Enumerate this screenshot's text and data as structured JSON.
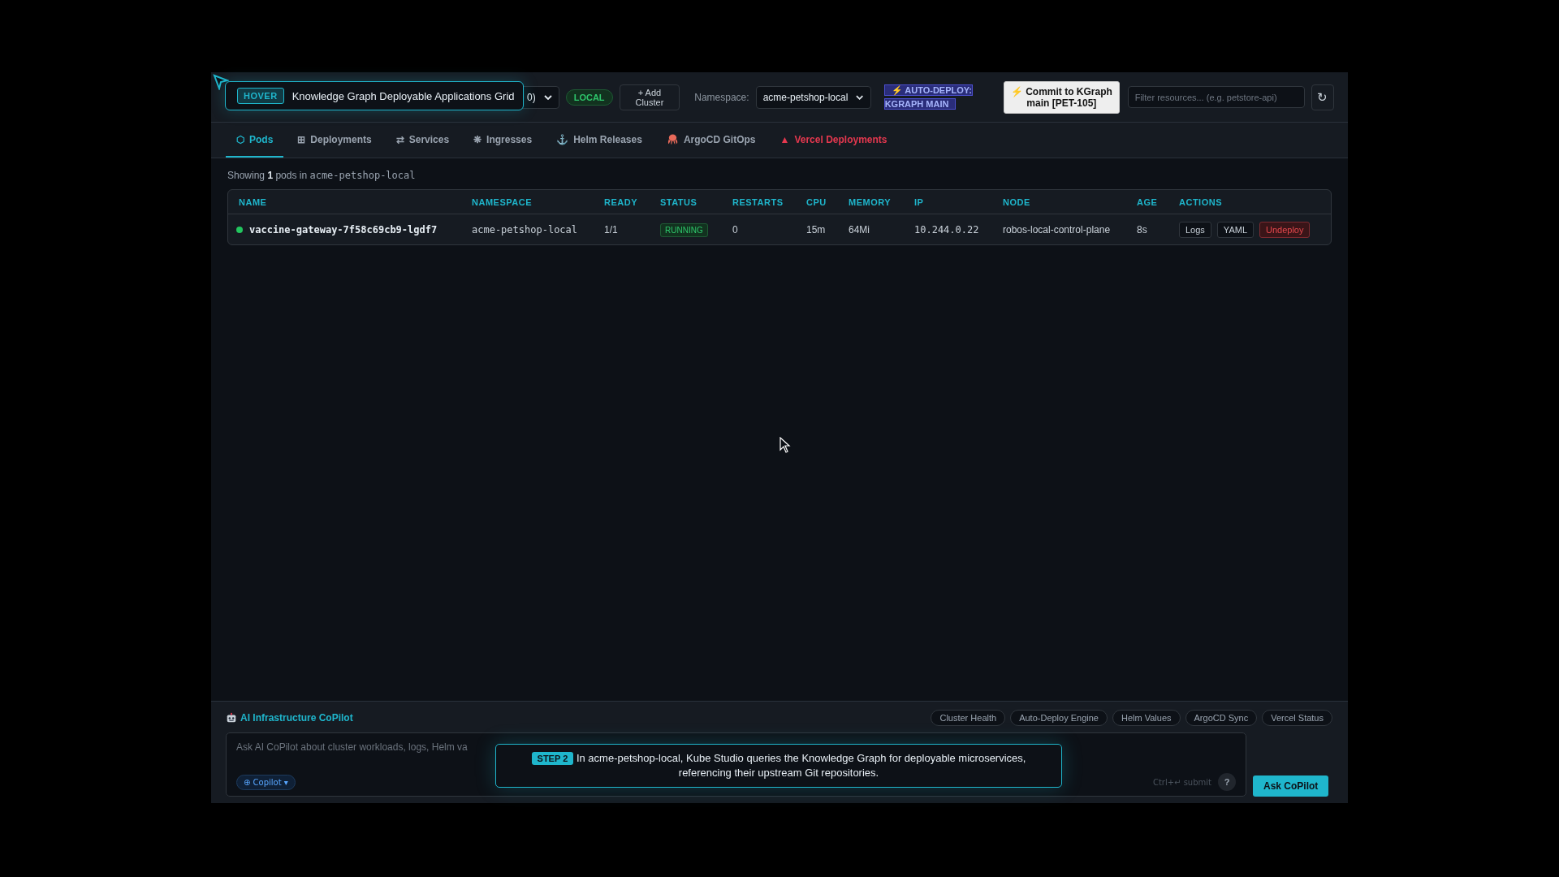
{
  "header": {
    "cluster_select": {
      "value": "0)"
    },
    "cluster_badge": "LOCAL",
    "add_cluster": "+ Add Cluster",
    "namespace_label": "Namespace:",
    "namespace_select": {
      "value": "acme-petshop-local"
    },
    "auto_deploy": {
      "line_1": "⚡ AUTO-DEPLOY:",
      "line_2": "KGRAPH MAIN"
    },
    "commit_button": "⚡ Commit to KGraph main [PET-105]",
    "filter": {
      "placeholder": "Filter resources... (e.g. petstore-api)"
    },
    "refresh": "↻"
  },
  "hover_tooltip": {
    "badge": "HOVER",
    "text": "Knowledge Graph Deployable Applications Grid"
  },
  "tabs": [
    {
      "kind": "glyph",
      "icon": "⬡",
      "label": "Pods",
      "selected": true
    },
    {
      "kind": "glyph",
      "icon": "⊞",
      "label": "Deployments",
      "selected": false
    },
    {
      "kind": "glyph",
      "icon": "⇄",
      "label": "Services",
      "selected": false
    },
    {
      "kind": "glyph",
      "icon": "❋",
      "label": "Ingresses",
      "selected": false
    },
    {
      "kind": "glyph",
      "icon": "⚓",
      "label": "Helm Releases",
      "selected": false
    },
    {
      "kind": "octopus",
      "label": "ArgoCD GitOps",
      "selected": false
    },
    {
      "kind": "glyph",
      "icon": "▲",
      "label": "Vercel Deployments",
      "selected": false,
      "color": "#e5384f"
    }
  ],
  "summary": {
    "text": "Showing **1** pods in",
    "namespace": "acme-petshop-local"
  },
  "table": {
    "columns": [
      "NAME",
      "NAMESPACE",
      "READY",
      "STATUS",
      "RESTARTS",
      "CPU",
      "MEMORY",
      "IP",
      "NODE",
      "AGE",
      "ACTIONS"
    ],
    "rows": [
      {
        "name": "vaccine-gateway-7f58c69cb9-lgdf7",
        "color": "#22c55e",
        "namespace": "acme-petshop-local",
        "ready": "1/1",
        "status": "RUNNING",
        "restarts": "0",
        "cpu": "15m",
        "memory": "64Mi",
        "ip": "10.244.0.22",
        "node": "robos-local-control-plane",
        "age": "8s",
        "actions": [
          {
            "kind": "plain",
            "label": "Logs"
          },
          {
            "kind": "plain",
            "label": "YAML"
          },
          {
            "kind": "danger",
            "label": "Undeploy"
          }
        ]
      }
    ]
  },
  "copilot": {
    "title": "AI Infrastructure CoPilot",
    "chips": [
      "Cluster Health",
      "Auto-Deploy Engine",
      "Helm Values",
      "ArgoCD Sync",
      "Vercel Status"
    ],
    "input": {
      "placeholder": "Ask AI CoPilot about cluster workloads, logs, Helm va"
    },
    "model": "⊕ Copilot ▾",
    "hint": "Ctrl+↵ submit",
    "help": "?",
    "ask_button": "Ask CoPilot"
  },
  "step_callout": {
    "badge": "STEP 2",
    "text": "In acme-petshop-local, Kube Studio queries the Knowledge Graph for deployable microservices, referencing their upstream Git repositories."
  }
}
